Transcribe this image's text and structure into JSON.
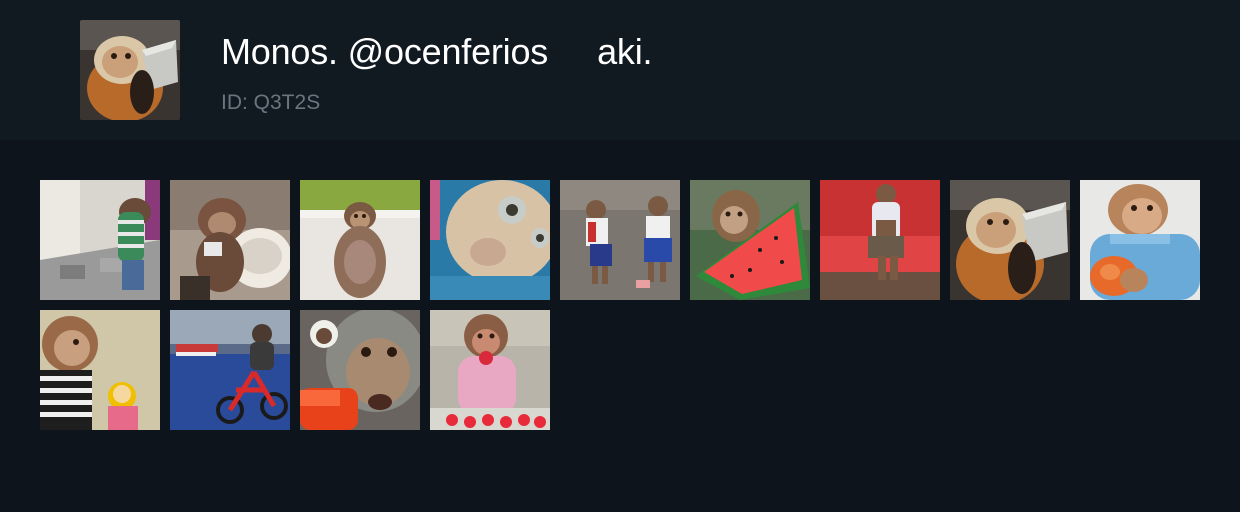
{
  "channel": {
    "title": "Monos. @ocenferios     aki.",
    "id_text": "ID: Q3T2S"
  },
  "thumbnails": [
    {
      "label": "monkey-in-striped-shirt-hallway"
    },
    {
      "label": "monkey-by-toilet"
    },
    {
      "label": "monkey-in-bathtub"
    },
    {
      "label": "monkey-face-closeup-blue-towel"
    },
    {
      "label": "two-monkeys-in-school-uniforms"
    },
    {
      "label": "monkey-eating-watermelon"
    },
    {
      "label": "monkey-on-red-couch"
    },
    {
      "label": "monkey-drinking-from-cup"
    },
    {
      "label": "monkey-in-blue-sweater-with-orange"
    },
    {
      "label": "monkey-with-doll"
    },
    {
      "label": "monkey-on-red-balance-bike"
    },
    {
      "label": "monkey-with-plush-and-orange-toy"
    },
    {
      "label": "monkey-in-pink-eating-strawberries"
    }
  ]
}
